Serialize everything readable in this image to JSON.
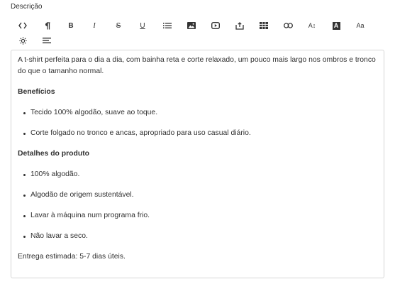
{
  "field": {
    "label": "Descrição"
  },
  "toolbar": {
    "buttons": [
      {
        "name": "code-view",
        "icon": "code-icon",
        "glyph": "<>"
      },
      {
        "name": "paragraph",
        "icon": "paragraph-icon",
        "glyph": "¶"
      },
      {
        "name": "bold",
        "icon": "bold-icon",
        "glyph": "B"
      },
      {
        "name": "italic",
        "icon": "italic-icon",
        "glyph": "I"
      },
      {
        "name": "strikethrough",
        "icon": "strikethrough-icon",
        "glyph": "S"
      },
      {
        "name": "underline",
        "icon": "underline-icon",
        "glyph": "U"
      },
      {
        "name": "bullet-list",
        "icon": "list-icon",
        "glyph": ""
      },
      {
        "name": "image",
        "icon": "image-icon",
        "glyph": ""
      },
      {
        "name": "video",
        "icon": "video-icon",
        "glyph": ""
      },
      {
        "name": "embed",
        "icon": "embed-icon",
        "glyph": ""
      },
      {
        "name": "table",
        "icon": "table-icon",
        "glyph": ""
      },
      {
        "name": "link",
        "icon": "link-icon",
        "glyph": ""
      },
      {
        "name": "font-size",
        "icon": "font-size-icon",
        "glyph": "A↕"
      },
      {
        "name": "text-color",
        "icon": "text-color-icon",
        "glyph": "A"
      },
      {
        "name": "font-case",
        "icon": "font-case-icon",
        "glyph": "Aa"
      },
      {
        "name": "highlight",
        "icon": "sun-icon",
        "glyph": ""
      },
      {
        "name": "align",
        "icon": "align-left-icon",
        "glyph": ""
      }
    ]
  },
  "content": {
    "intro": "A t-shirt perfeita para o dia a dia, com bainha reta e corte relaxado, um pouco mais largo nos ombros e tronco do que o tamanho normal.",
    "benefits_heading": "Benefícios",
    "benefits": [
      "Tecido 100% algodão, suave ao toque.",
      "Corte folgado no tronco e ancas, apropriado para uso casual diário."
    ],
    "details_heading": "Detalhes do produto",
    "details": [
      "100% algodão.",
      "Algodão de origem sustentável.",
      "Lavar à máquina num programa frio.",
      "Não lavar a seco."
    ],
    "delivery": "Entrega estimada: 5-7 dias úteis."
  },
  "colors": {
    "text": "#303030",
    "border": "#d6d6d6"
  }
}
